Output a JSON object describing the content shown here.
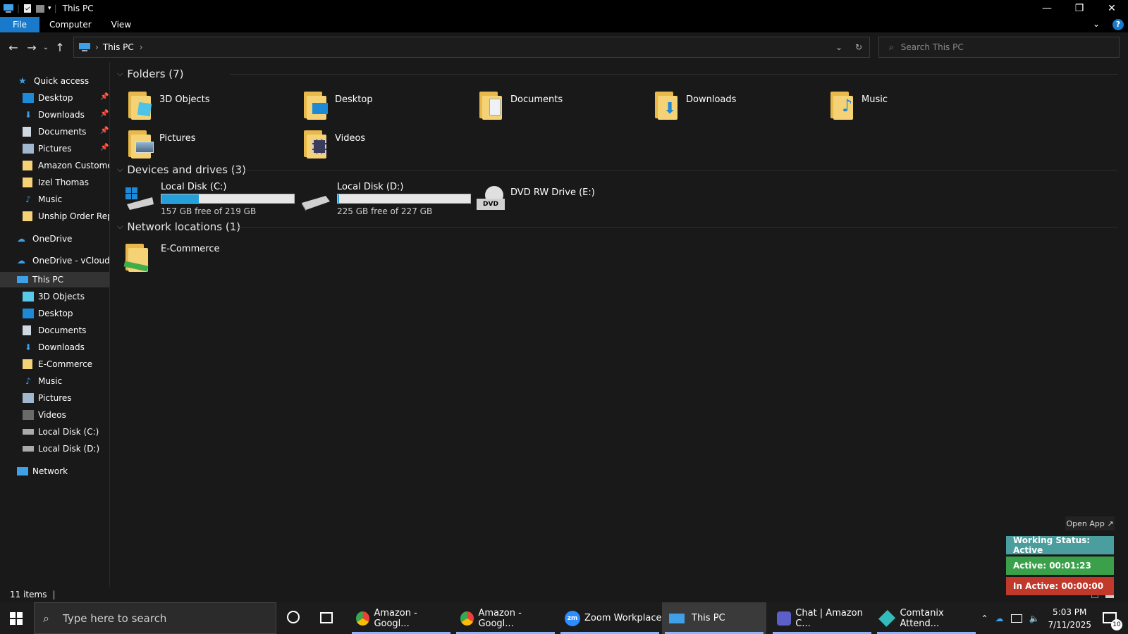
{
  "window": {
    "title": "This PC",
    "controls": {
      "minimize": "—",
      "restore": "❐",
      "close": "✕"
    }
  },
  "ribbon": {
    "tabs": [
      "File",
      "Computer",
      "View"
    ],
    "help": "?"
  },
  "address": {
    "crumbs": [
      "This PC"
    ],
    "search_placeholder": "Search This PC"
  },
  "sidebar": {
    "quick_access": "Quick access",
    "quick_items": [
      {
        "label": "Desktop",
        "pinned": true
      },
      {
        "label": "Downloads",
        "pinned": true
      },
      {
        "label": "Documents",
        "pinned": true
      },
      {
        "label": "Pictures",
        "pinned": true
      },
      {
        "label": "Amazon Customer",
        "pinned": false
      },
      {
        "label": "Izel Thomas",
        "pinned": false
      },
      {
        "label": "Music",
        "pinned": false
      },
      {
        "label": "Unship Order Repor",
        "pinned": false
      }
    ],
    "onedrive": "OneDrive",
    "onedrive_business": "OneDrive - vCloud Cl",
    "this_pc": "This PC",
    "pc_items": [
      "3D Objects",
      "Desktop",
      "Documents",
      "Downloads",
      "E-Commerce",
      "Music",
      "Pictures",
      "Videos",
      "Local Disk (C:)",
      "Local Disk (D:)"
    ],
    "network": "Network"
  },
  "main": {
    "folders_header": "Folders (7)",
    "folders": [
      "3D Objects",
      "Desktop",
      "Documents",
      "Downloads",
      "Music",
      "Pictures",
      "Videos"
    ],
    "devices_header": "Devices and drives (3)",
    "drives": [
      {
        "name": "Local Disk (C:)",
        "free": "157 GB free of 219 GB",
        "used_fraction": 0.28
      },
      {
        "name": "Local Disk (D:)",
        "free": "225 GB free of 227 GB",
        "used_fraction": 0.01
      }
    ],
    "dvd": "DVD RW Drive (E:)",
    "dvd_label": "DVD",
    "network_header": "Network locations (1)",
    "network_items": [
      "E-Commerce"
    ]
  },
  "status": {
    "items": "11 items"
  },
  "widget": {
    "open_app": "Open App ↗",
    "working_status": "Working Status: Active",
    "active": "Active: 00:01:23",
    "inactive": "In Active: 00:00:00",
    "colors": {
      "status": "#4a9e9e",
      "active": "#3aa04a",
      "inactive": "#c0392b"
    }
  },
  "taskbar": {
    "search_placeholder": "Type here to search",
    "apps": [
      {
        "label": "Amazon - Googl..."
      },
      {
        "label": "Amazon - Googl..."
      },
      {
        "label": "Zoom Workplace"
      },
      {
        "label": "This PC"
      },
      {
        "label": "Chat | Amazon C..."
      },
      {
        "label": "Comtanix Attend..."
      }
    ],
    "time": "5:03 PM",
    "date": "7/11/2025",
    "notifications": "10"
  }
}
